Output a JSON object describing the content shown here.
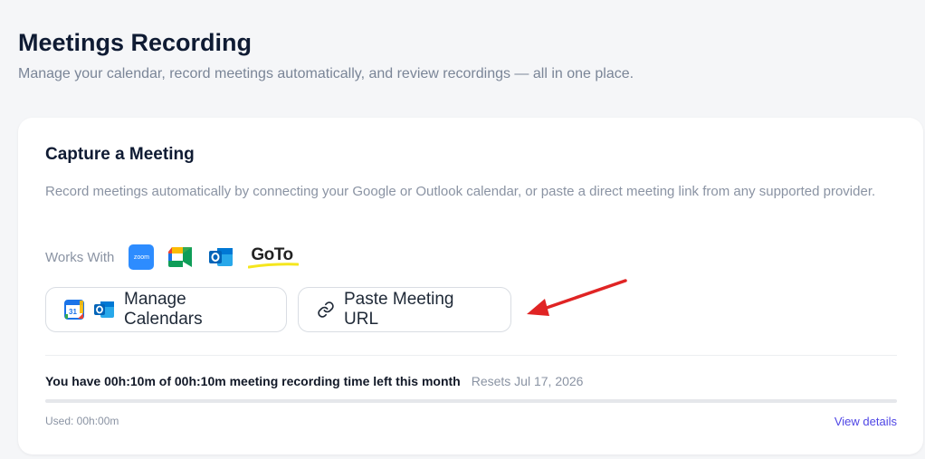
{
  "header": {
    "title": "Meetings Recording",
    "subtitle": "Manage your calendar, record meetings automatically, and review recordings — all in one place."
  },
  "card": {
    "title": "Capture a Meeting",
    "description": "Record meetings automatically by connecting your Google or Outlook calendar, or paste a direct meeting link from any supported provider.",
    "works_with_label": "Works With",
    "providers": [
      {
        "name": "zoom",
        "icon": "zoom-icon",
        "label": "zoom"
      },
      {
        "name": "google-meet",
        "icon": "google-meet-icon"
      },
      {
        "name": "outlook",
        "icon": "outlook-icon"
      },
      {
        "name": "goto",
        "icon": "goto-icon",
        "label": "GoTo"
      }
    ],
    "manage_calendars_label": "Manage Calendars",
    "paste_url_label": "Paste Meeting URL",
    "google_calendar_day": "31"
  },
  "quota": {
    "text": "You have 00h:10m of 00h:10m meeting recording time left this month",
    "resets": "Resets Jul 17, 2026",
    "used": "Used: 00h:00m",
    "used_fraction": 0,
    "view_details_label": "View details"
  },
  "colors": {
    "accent": "#4f46e5",
    "arrow": "#e02424"
  }
}
